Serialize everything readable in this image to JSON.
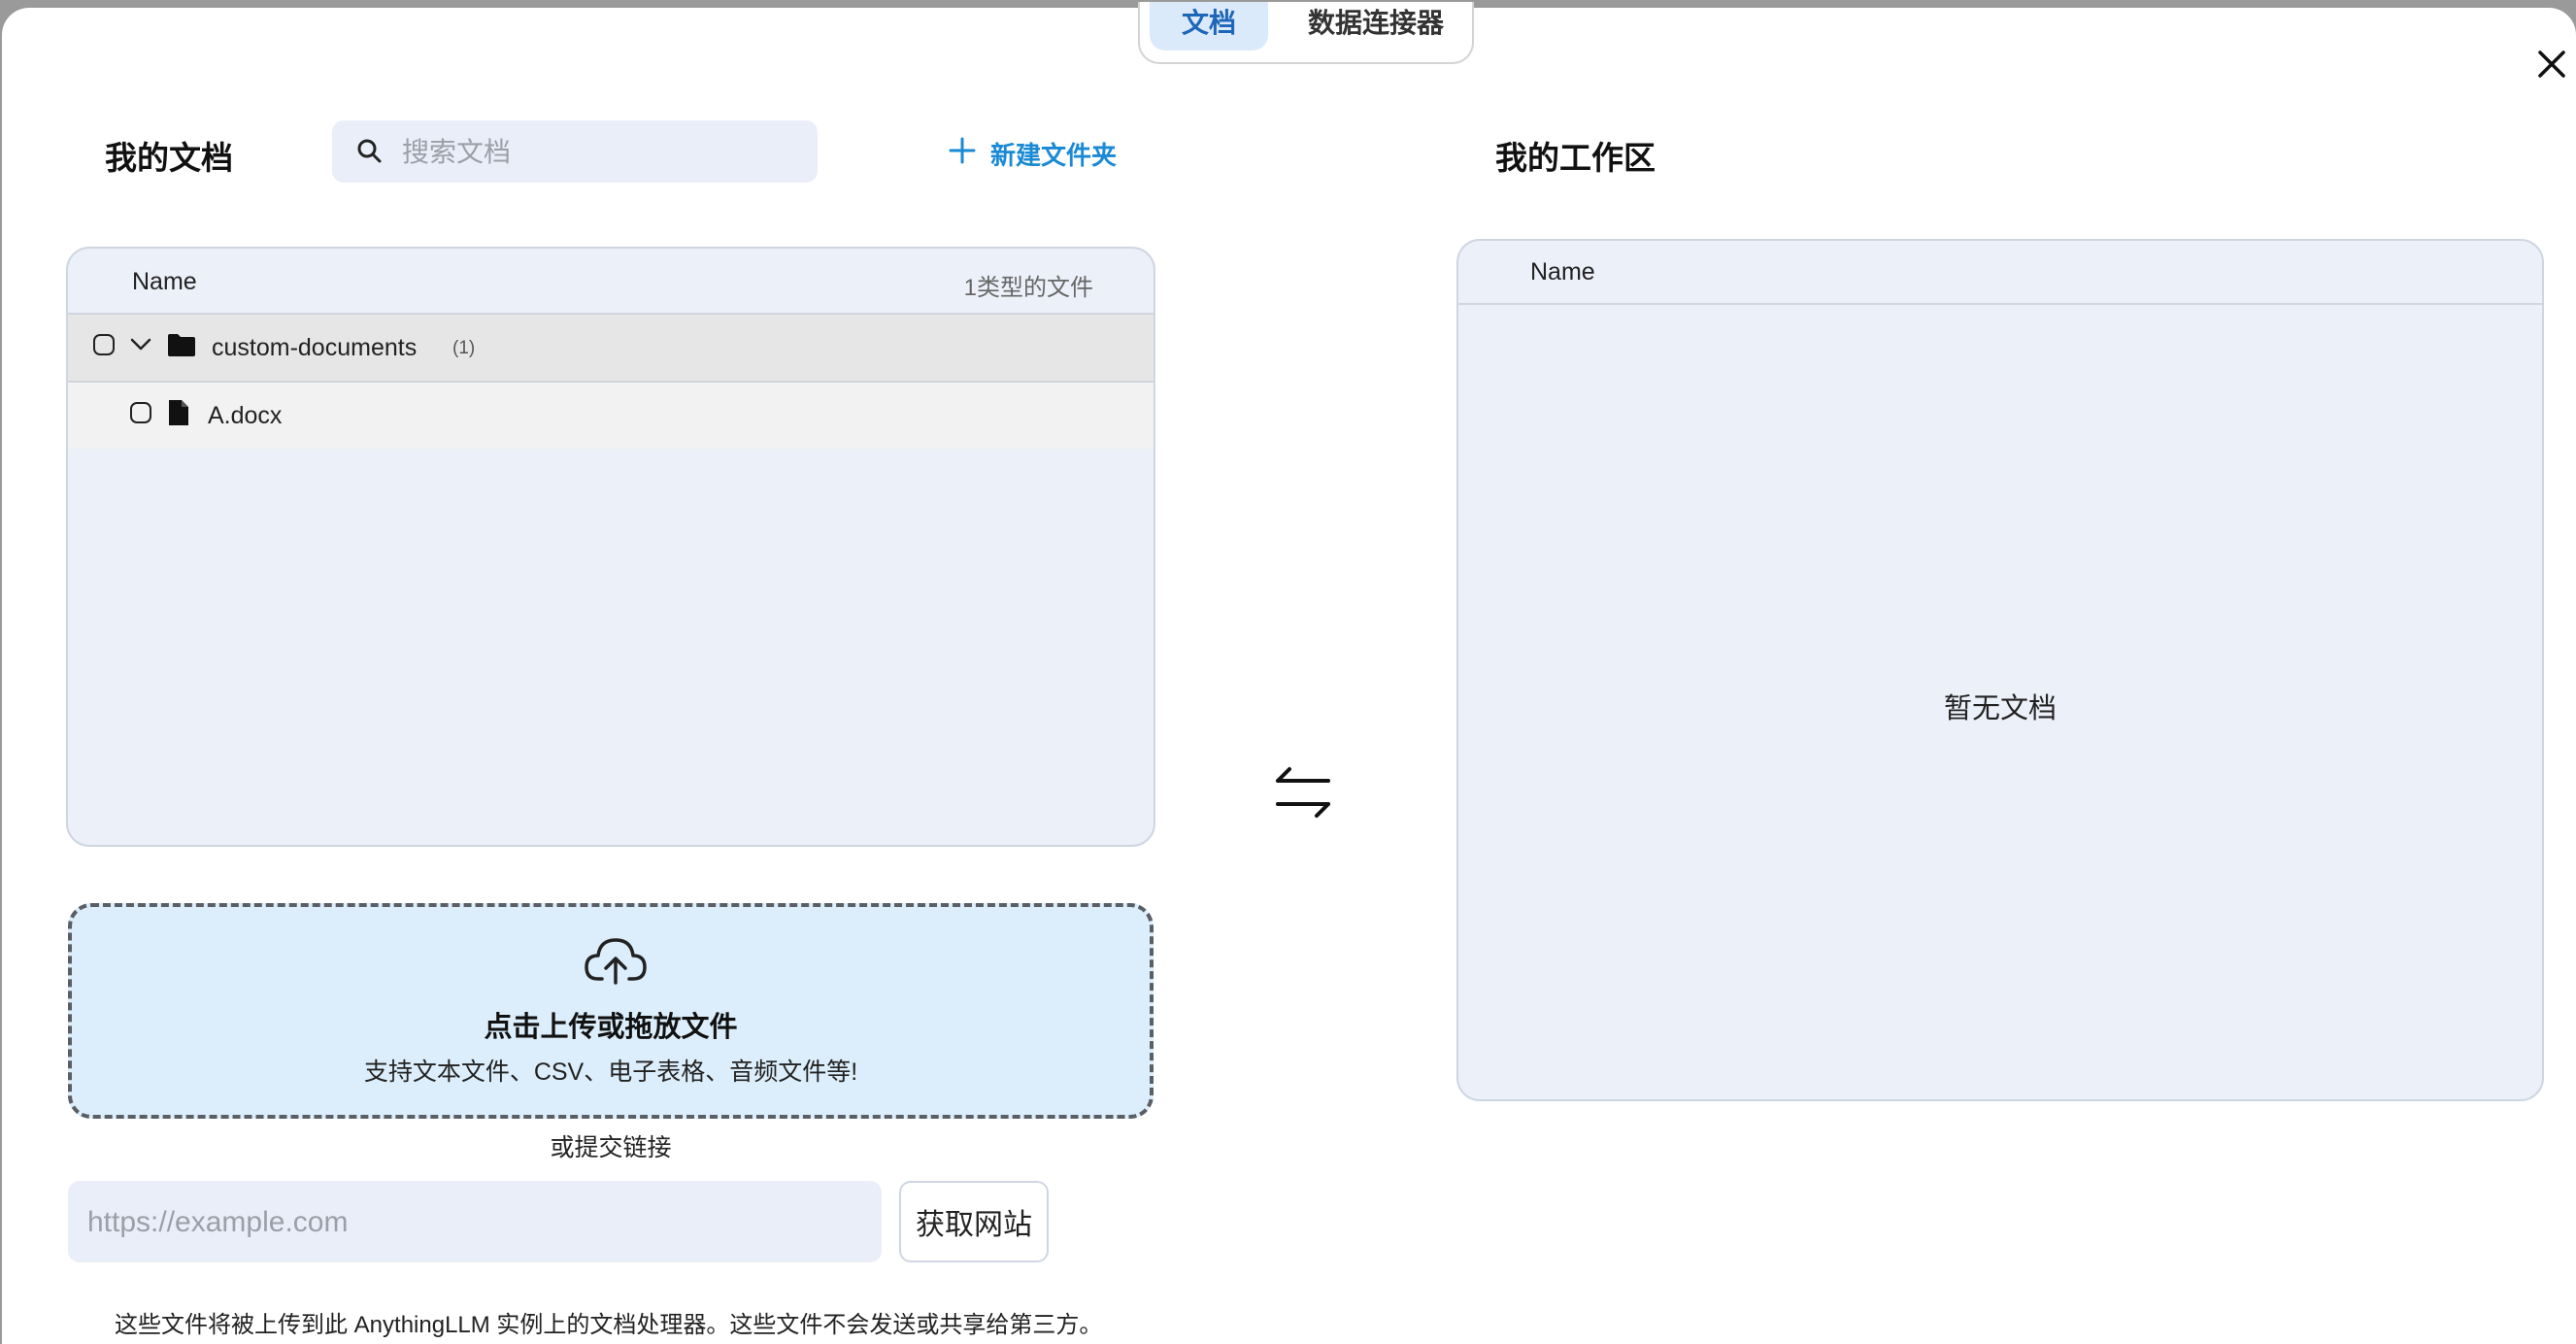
{
  "tabs": [
    {
      "label": "文档",
      "active": true
    },
    {
      "label": "数据连接器",
      "active": false
    }
  ],
  "left": {
    "title": "我的文档",
    "search_placeholder": "搜索文档",
    "new_folder": "新建文件夹",
    "table": {
      "name_header": "Name",
      "type_count": "1类型的文件",
      "folder": {
        "name": "custom-documents",
        "count": "(1)"
      },
      "files": [
        {
          "name": "A.docx"
        }
      ]
    }
  },
  "right": {
    "title": "我的工作区",
    "name_header": "Name",
    "empty_text": "暂无文档"
  },
  "upload": {
    "title": "点击上传或拖放文件",
    "subtitle": "支持文本文件、CSV、电子表格、音频文件等!",
    "or_link": "或提交链接",
    "url_placeholder": "https://example.com",
    "fetch_label": "获取网站",
    "footer_note": "这些文件将被上传到此 AnythingLLM 实例上的文档处理器。这些文件不会发送或共享给第三方。"
  },
  "icons": [
    "close-icon",
    "search-icon",
    "plus-icon",
    "chevron-down-icon",
    "folder-icon",
    "file-icon",
    "swap-arrows-icon",
    "cloud-upload-icon"
  ],
  "colors": {
    "accent_blue": "#1a8ad4",
    "active_tab_bg": "#dbeafb",
    "panel_bg": "#ecf0f8",
    "dropzone_bg": "#dceefb"
  }
}
